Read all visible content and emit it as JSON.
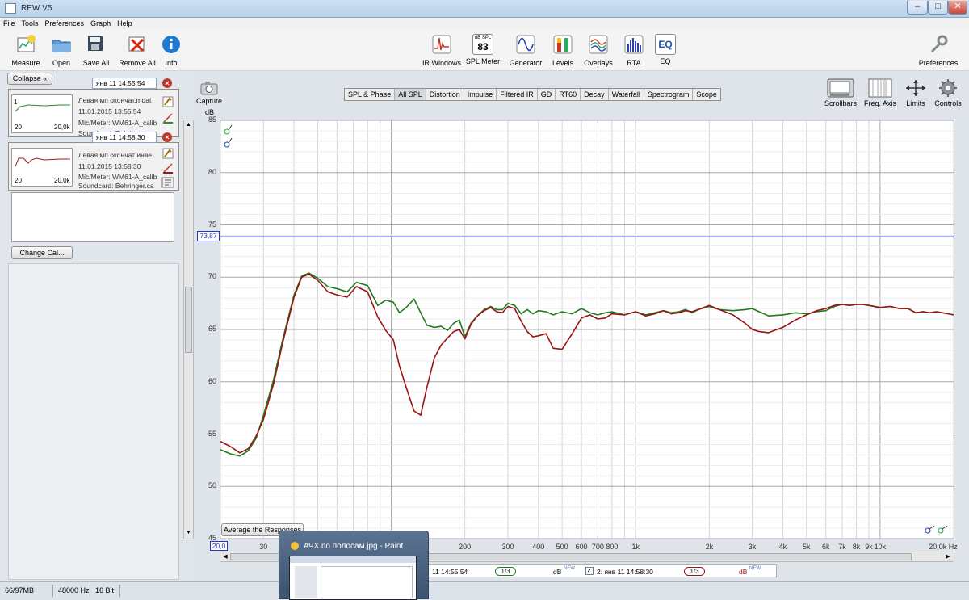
{
  "window": {
    "title": "REW V5",
    "min": "–",
    "max": "□",
    "close": "✕"
  },
  "menu": [
    "File",
    "Tools",
    "Preferences",
    "Graph",
    "Help"
  ],
  "toolbar_left": [
    {
      "label": "Measure",
      "icon": "measure-icon"
    },
    {
      "label": "Open",
      "icon": "folder-icon"
    },
    {
      "label": "Save All",
      "icon": "save-icon"
    },
    {
      "label": "Remove All",
      "icon": "remove-icon"
    },
    {
      "label": "Info",
      "icon": "info-icon"
    }
  ],
  "toolbar_center": [
    {
      "label": "IR Windows",
      "icon": "ir-windows-icon"
    },
    {
      "label": "SPL Meter",
      "icon": "spl-meter-icon",
      "badge_top": "dB SPL",
      "badge_value": "83"
    },
    {
      "label": "Generator",
      "icon": "generator-icon"
    },
    {
      "label": "Levels",
      "icon": "levels-icon"
    },
    {
      "label": "Overlays",
      "icon": "overlays-icon"
    },
    {
      "label": "RTA",
      "icon": "rta-icon"
    },
    {
      "label": "EQ",
      "icon": "eq-icon",
      "badge_value": "EQ"
    }
  ],
  "toolbar_right": {
    "label": "Preferences",
    "icon": "wrench-icon"
  },
  "leftpanel": {
    "collapse": "Collapse",
    "measurements": [
      {
        "name": "янв 11 14:55:54",
        "thumb_top": "1",
        "thumb_left": "20",
        "thumb_right": "20,0k",
        "line1": "Левая мп окончат.mdat",
        "line2": "11.01.2015 13:55:54",
        "line3": "Mic/Meter: WM61-A_calib",
        "line4": "Soundcard: Behringer.ca",
        "color": "#2e8b2e"
      },
      {
        "name": "янв 11 14:58:30",
        "thumb_left": "20",
        "thumb_right": "20,0k",
        "line1": "Левая мп окончат инве",
        "line2": "11.01.2015 13:58:30",
        "line3": "Mic/Meter: WM61-A_calib",
        "line4": "Soundcard: Behringer.ca",
        "color": "#a01818"
      }
    ],
    "change_cal": "Change Cal..."
  },
  "capture": "Capture",
  "graph_tabs": [
    "SPL & Phase",
    "All SPL",
    "Distortion",
    "Impulse",
    "Filtered IR",
    "GD",
    "RT60",
    "Decay",
    "Waterfall",
    "Spectrogram",
    "Scope"
  ],
  "selected_tab": "All SPL",
  "graph_controls": [
    "Scrollbars",
    "Freq. Axis",
    "Limits",
    "Controls"
  ],
  "avg_button": "Average the Responses",
  "xstart": "20,0",
  "legend": {
    "item1_name": "11 14:55:54",
    "item1_smoothing": "1/3",
    "item1_unit": "dB",
    "item1_sup": "NEW",
    "item2_name": "2: янв 11 14:58:30",
    "item2_smoothing": "1/3",
    "item2_unit": "dB",
    "item2_sup": "NEW"
  },
  "status": {
    "memory": "66/97MB",
    "rate": "48000 Hz",
    "bits": "16 Bit"
  },
  "taskbar_thumb": {
    "title": "АЧХ по полосам.jpg - Paint"
  },
  "chart_data": {
    "type": "line",
    "ylabel": "dB",
    "xlabel": "Hz",
    "x_scale": "log",
    "xlim": [
      20,
      20000
    ],
    "ylim": [
      45,
      85
    ],
    "y_ticks": [
      "85",
      "80",
      "75",
      "70",
      "65",
      "60",
      "55",
      "50",
      "45"
    ],
    "x_ticks": [
      {
        "v": 30,
        "l": "30"
      },
      {
        "v": 200,
        "l": "200"
      },
      {
        "v": 300,
        "l": "300"
      },
      {
        "v": 400,
        "l": "400"
      },
      {
        "v": 500,
        "l": "500"
      },
      {
        "v": 600,
        "l": "600"
      },
      {
        "v": 700,
        "l": "700"
      },
      {
        "v": 800,
        "l": "800"
      },
      {
        "v": 1000,
        "l": "1k"
      },
      {
        "v": 2000,
        "l": "2k"
      },
      {
        "v": 3000,
        "l": "3k"
      },
      {
        "v": 4000,
        "l": "4k"
      },
      {
        "v": 5000,
        "l": "5k"
      },
      {
        "v": 6000,
        "l": "6k"
      },
      {
        "v": 7000,
        "l": "7k"
      },
      {
        "v": 8000,
        "l": "8k"
      },
      {
        "v": 9000,
        "l": "9k"
      },
      {
        "v": 10000,
        "l": "10k"
      },
      {
        "v": 20000,
        "l": "20,0k Hz"
      }
    ],
    "hline": {
      "value": 73.87,
      "label": "73,87",
      "color": "#2233cc"
    },
    "series": [
      {
        "color": "#1f7a1f",
        "x": [
          20,
          22,
          24,
          26,
          28,
          30,
          33,
          36,
          40,
          43,
          46,
          50,
          55,
          60,
          66,
          72,
          80,
          88,
          95,
          102,
          108,
          115,
          124,
          132,
          140,
          150,
          160,
          170,
          180,
          190,
          200,
          212,
          225,
          240,
          255,
          270,
          285,
          300,
          320,
          340,
          360,
          380,
          400,
          430,
          460,
          500,
          550,
          600,
          650,
          700,
          750,
          800,
          900,
          1000,
          1100,
          1200,
          1300,
          1400,
          1500,
          1600,
          1700,
          1800,
          2000,
          2200,
          2500,
          2800,
          3000,
          3200,
          3500,
          4000,
          4500,
          5000,
          5500,
          6000,
          6500,
          7000,
          7500,
          8000,
          8500,
          9000,
          10000,
          11000,
          12000,
          13000,
          14000,
          15000,
          16000,
          17000,
          18000,
          19000,
          20000
        ],
        "y": [
          53.5,
          53.1,
          52.9,
          53.4,
          54.6,
          56.8,
          60.2,
          64.1,
          68.3,
          70.1,
          70.4,
          69.9,
          69.1,
          68.9,
          68.6,
          69.5,
          69.2,
          67.3,
          67.8,
          67.6,
          66.6,
          67.1,
          67.9,
          66.6,
          65.4,
          65.2,
          65.3,
          64.9,
          65.6,
          65.9,
          64.3,
          65.6,
          66.3,
          66.9,
          67.2,
          66.9,
          66.9,
          67.5,
          67.3,
          66.5,
          66.9,
          66.5,
          66.8,
          66.7,
          66.4,
          66.7,
          66.5,
          67.0,
          66.6,
          66.4,
          66.6,
          66.7,
          66.4,
          66.7,
          66.4,
          66.6,
          66.8,
          66.6,
          66.7,
          66.9,
          66.6,
          66.9,
          67.2,
          66.9,
          66.8,
          66.9,
          67.0,
          66.7,
          66.3,
          66.4,
          66.6,
          66.5,
          66.7,
          66.8,
          67.2,
          67.4,
          67.3,
          67.4,
          67.4,
          67.3,
          67.1,
          67.2,
          67.0,
          67.0,
          66.6,
          66.7,
          66.6,
          66.7,
          66.6,
          66.5,
          66.4
        ]
      },
      {
        "color": "#9b1414",
        "x": [
          20,
          22,
          24,
          26,
          28,
          30,
          33,
          36,
          40,
          43,
          46,
          50,
          55,
          60,
          66,
          72,
          80,
          88,
          95,
          102,
          108,
          115,
          124,
          132,
          140,
          150,
          160,
          170,
          180,
          190,
          200,
          212,
          225,
          240,
          255,
          270,
          285,
          300,
          320,
          340,
          360,
          380,
          400,
          430,
          460,
          500,
          550,
          600,
          650,
          700,
          750,
          800,
          900,
          1000,
          1100,
          1200,
          1300,
          1400,
          1500,
          1600,
          1700,
          1800,
          2000,
          2200,
          2500,
          2800,
          3000,
          3200,
          3500,
          4000,
          4500,
          5000,
          5500,
          6000,
          6500,
          7000,
          7500,
          8000,
          8500,
          9000,
          10000,
          11000,
          12000,
          13000,
          14000,
          15000,
          16000,
          17000,
          18000,
          19000,
          20000
        ],
        "y": [
          54.3,
          53.8,
          53.2,
          53.6,
          54.8,
          56.4,
          59.8,
          63.8,
          68.1,
          70.0,
          70.3,
          69.7,
          68.6,
          68.3,
          68.1,
          69.1,
          68.6,
          66.2,
          64.9,
          64.0,
          61.5,
          59.5,
          57.2,
          56.8,
          59.5,
          62.3,
          63.5,
          64.2,
          64.8,
          65.0,
          64.1,
          65.5,
          66.3,
          66.8,
          67.1,
          66.7,
          66.6,
          67.2,
          67.0,
          65.8,
          64.8,
          64.3,
          64.4,
          64.6,
          63.2,
          63.1,
          64.6,
          66.1,
          66.4,
          66.0,
          66.1,
          66.5,
          66.4,
          66.7,
          66.3,
          66.5,
          66.8,
          66.5,
          66.6,
          66.8,
          66.7,
          66.9,
          67.3,
          66.9,
          66.4,
          65.6,
          65.0,
          64.8,
          64.7,
          65.2,
          65.9,
          66.4,
          66.8,
          67.0,
          67.3,
          67.4,
          67.3,
          67.4,
          67.4,
          67.3,
          67.1,
          67.2,
          67.0,
          67.0,
          66.6,
          66.7,
          66.6,
          66.7,
          66.6,
          66.5,
          66.4
        ]
      }
    ]
  }
}
